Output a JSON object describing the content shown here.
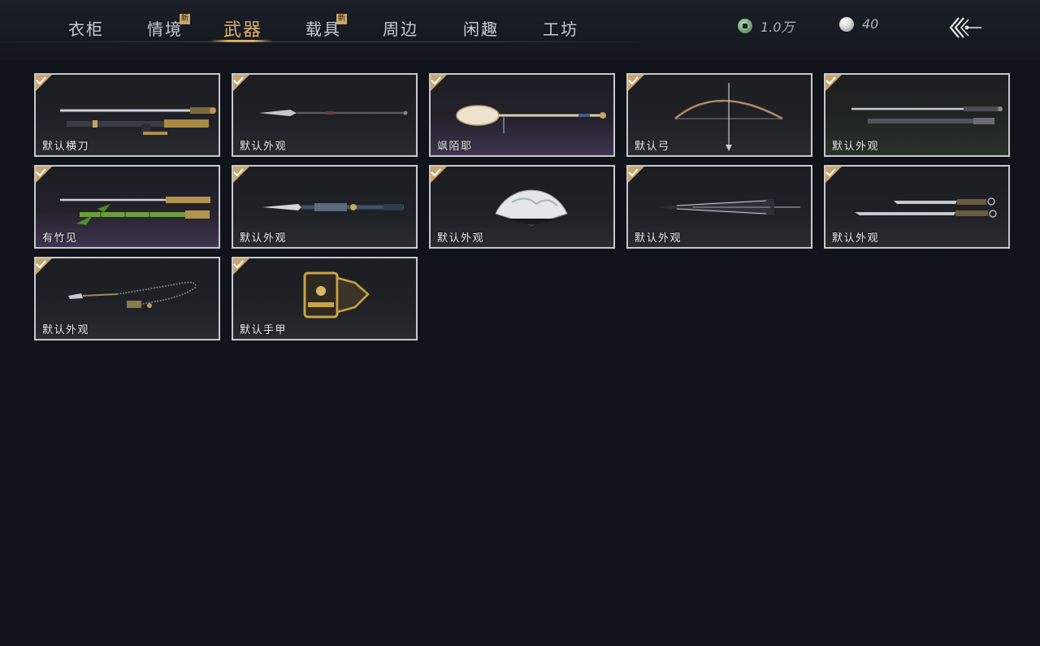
{
  "tabs": [
    {
      "label": "衣柜",
      "active": false,
      "badge": ""
    },
    {
      "label": "情境",
      "active": false,
      "badge": "新"
    },
    {
      "label": "武器",
      "active": true,
      "badge": ""
    },
    {
      "label": "载具",
      "active": false,
      "badge": "新"
    },
    {
      "label": "周边",
      "active": false,
      "badge": ""
    },
    {
      "label": "闲趣",
      "active": false,
      "badge": ""
    },
    {
      "label": "工坊",
      "active": false,
      "badge": ""
    }
  ],
  "currency": {
    "jade": {
      "icon": "jade-coin-icon",
      "value": "1.0万"
    },
    "pearl": {
      "icon": "pearl-icon",
      "value": "40"
    }
  },
  "colors": {
    "accent": "#e2b26a",
    "background": "#10131a",
    "card_border": "#c6c8cc",
    "check": "#c9a46a"
  },
  "items": [
    {
      "label": "默认横刀",
      "owned": true,
      "icon": "saber-icon"
    },
    {
      "label": "默认外观",
      "owned": true,
      "icon": "glaive-icon"
    },
    {
      "label": "飒陌耶",
      "owned": true,
      "icon": "mirror-staff-icon"
    },
    {
      "label": "默认弓",
      "owned": true,
      "icon": "bow-icon"
    },
    {
      "label": "默认外观",
      "owned": true,
      "icon": "twin-swords-icon"
    },
    {
      "label": "有竹见",
      "owned": true,
      "icon": "bamboo-sword-icon"
    },
    {
      "label": "默认外观",
      "owned": true,
      "icon": "spear-icon"
    },
    {
      "label": "默认外观",
      "owned": true,
      "icon": "fan-icon"
    },
    {
      "label": "默认外观",
      "owned": true,
      "icon": "umbrella-icon"
    },
    {
      "label": "默认外观",
      "owned": true,
      "icon": "dual-blades-icon"
    },
    {
      "label": "默认外观",
      "owned": true,
      "icon": "rope-dart-icon"
    },
    {
      "label": "默认手甲",
      "owned": true,
      "icon": "gauntlet-icon"
    }
  ]
}
